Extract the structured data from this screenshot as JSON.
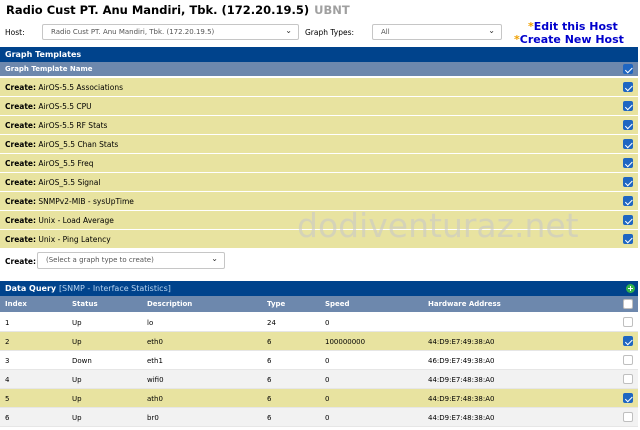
{
  "header": {
    "title": "Radio Cust PT. Anu Mandiri, Tbk. (172.20.19.5)",
    "subtitle": "UBNT"
  },
  "filter": {
    "host_label": "Host:",
    "host_value": "Radio Cust PT. Anu Mandiri, Tbk. (172.20.19.5)",
    "graph_types_label": "Graph Types:",
    "graph_types_value": "All"
  },
  "links": {
    "star": "*",
    "edit_host": "Edit this Host",
    "create_host": "Create New Host"
  },
  "graph_templates": {
    "panel_title": "Graph Templates",
    "column_header": "Graph Template Name",
    "create_prefix": "Create:",
    "rows": [
      {
        "name": "AirOS-5.5 Associations",
        "checked": true
      },
      {
        "name": "AirOS-5.5 CPU",
        "checked": true
      },
      {
        "name": "AirOS-5.5 RF Stats",
        "checked": true
      },
      {
        "name": "AirOS_5.5 Chan Stats",
        "checked": true
      },
      {
        "name": "AirOS_5.5 Freq",
        "checked": true
      },
      {
        "name": "AirOS_5.5 Signal",
        "checked": true
      },
      {
        "name": "SNMPv2-MIB - sysUpTime",
        "checked": true
      },
      {
        "name": "Unix - Load Average",
        "checked": true
      },
      {
        "name": "Unix - Ping Latency",
        "checked": true
      }
    ],
    "create_label": "Create:",
    "create_placeholder": "(Select a graph type to create)"
  },
  "data_query": {
    "panel_title": "Data Query",
    "query_name": "[SNMP - Interface Statistics]",
    "columns": [
      "Index",
      "Status",
      "Description",
      "Type",
      "Speed",
      "Hardware Address"
    ],
    "rows": [
      {
        "index": "1",
        "status": "Up",
        "description": "lo",
        "type": "24",
        "speed": "0",
        "hw": "",
        "checked": false
      },
      {
        "index": "2",
        "status": "Up",
        "description": "eth0",
        "type": "6",
        "speed": "100000000",
        "hw": "44:D9:E7:49:38:A0",
        "checked": true
      },
      {
        "index": "3",
        "status": "Down",
        "description": "eth1",
        "type": "6",
        "speed": "0",
        "hw": "46:D9:E7:49:38:A0",
        "checked": false
      },
      {
        "index": "4",
        "status": "Up",
        "description": "wifi0",
        "type": "6",
        "speed": "0",
        "hw": "44:D9:E7:48:38:A0",
        "checked": false
      },
      {
        "index": "5",
        "status": "Up",
        "description": "ath0",
        "type": "6",
        "speed": "0",
        "hw": "44:D9:E7:48:38:A0",
        "checked": true
      },
      {
        "index": "6",
        "status": "Up",
        "description": "br0",
        "type": "6",
        "speed": "0",
        "hw": "44:D9:E7:48:38:A0",
        "checked": false
      }
    ]
  },
  "watermark": "dodiventuraz.net",
  "colors": {
    "header_blue": "#00438c",
    "column_header": "#6d88ad",
    "selected_row": "#e8e3a0",
    "link_blue": "#0000cc",
    "star_orange": "#f0a000",
    "checkbox_blue": "#1e66c2"
  }
}
